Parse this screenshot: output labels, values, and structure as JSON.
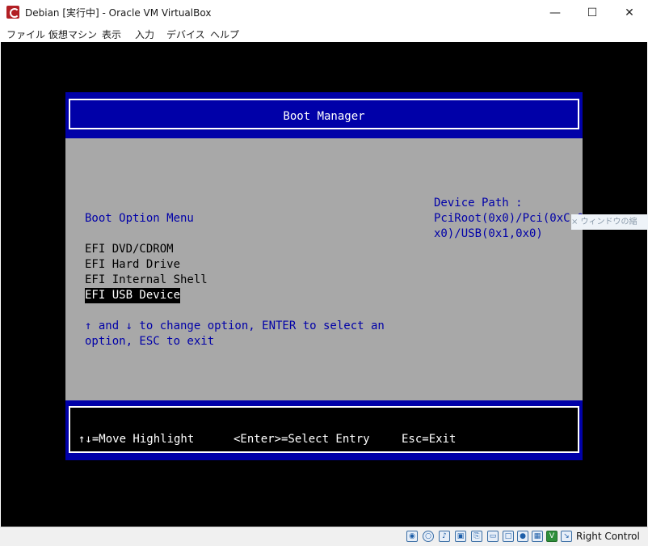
{
  "window": {
    "title": "Debian [実行中] - Oracle VM VirtualBox",
    "minimize_glyph": "—",
    "maximize_glyph": "☐",
    "close_glyph": "✕"
  },
  "menu": [
    "ファイル",
    "仮想マシン",
    "表示",
    "入力",
    "デバイス",
    "ヘルプ"
  ],
  "bios": {
    "title": "Boot Manager",
    "menu_heading": "Boot Option Menu",
    "options": [
      "EFI DVD/CDROM",
      "EFI Hard Drive",
      "EFI Internal Shell",
      "EFI USB Device"
    ],
    "selected_index": 3,
    "help_line1": "↑ and ↓ to change option, ENTER to select an",
    "help_line2": "option, ESC to exit",
    "device_path_label": "Device Path :",
    "device_path_line1": "PciRoot(0x0)/Pci(0xC,0",
    "device_path_line2": "x0)/USB(0x1,0x0)",
    "footer_move": "↑↓=Move Highlight",
    "footer_enter": "<Enter>=Select Entry",
    "footer_esc": "Esc=Exit",
    "colors": {
      "blue": "#0000a8",
      "gray": "#a8a8a8",
      "black": "#000000",
      "white": "#ffffff"
    }
  },
  "tooltip": {
    "text": "× ウィンドウの縮"
  },
  "statusbar": {
    "host_key_label": "Right Control",
    "icons": [
      "hard-disk-icon",
      "optical-drive-icon",
      "audio-icon",
      "network-icon",
      "usb-icon",
      "shared-folder-icon",
      "display-icon",
      "recording-icon",
      "cpu-icon",
      "virtualization-icon",
      "mouse-integration-icon",
      "host-key-icon"
    ]
  }
}
